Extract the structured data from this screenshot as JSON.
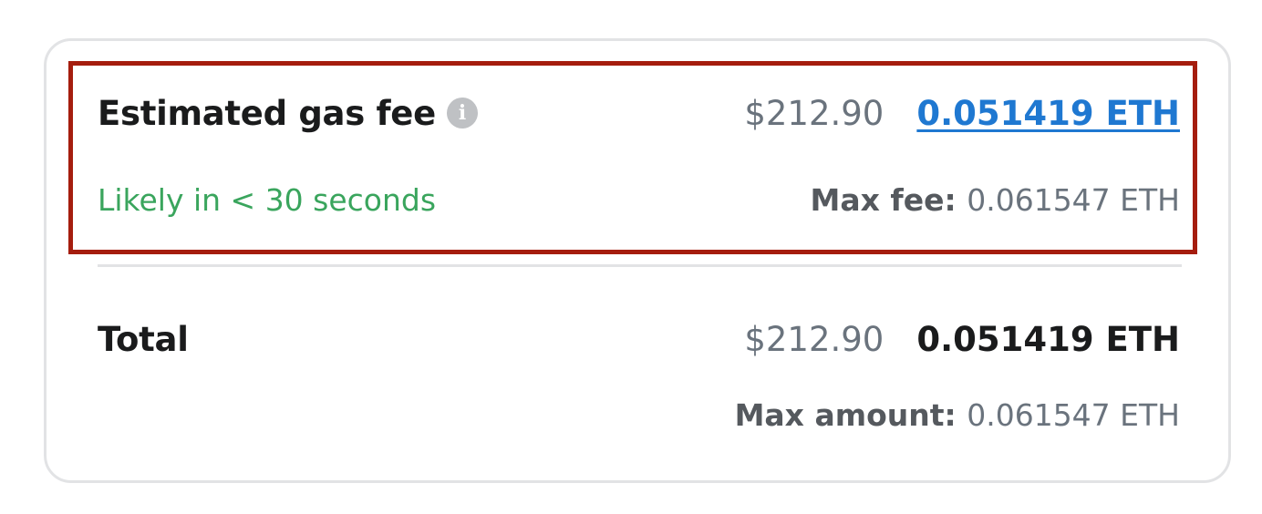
{
  "gas_fee": {
    "label": "Estimated gas fee",
    "info_icon_glyph": "i",
    "fiat_value": "$212.90",
    "eth_value": "0.051419 ETH",
    "timing": "Likely in < 30 seconds",
    "max_fee_label": "Max fee:",
    "max_fee_value": "0.061547 ETH"
  },
  "total": {
    "label": "Total",
    "fiat_value": "$212.90",
    "eth_value": "0.051419 ETH",
    "max_amount_label": "Max amount:",
    "max_amount_value": "0.061547 ETH"
  },
  "colors": {
    "highlight_border": "#a51d0e",
    "link": "#1f78d1",
    "success": "#3aa55d",
    "muted": "#6a737d"
  },
  "icons": {
    "info": "info-icon"
  }
}
